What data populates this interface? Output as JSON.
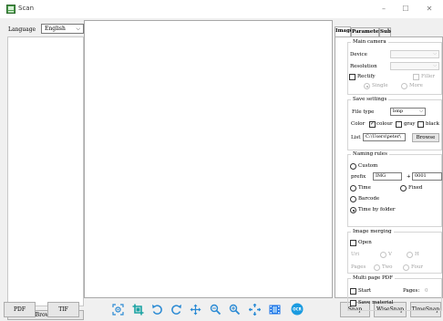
{
  "window": {
    "title": "Scan",
    "minimize": "–",
    "maximize": "☐",
    "close": "✕"
  },
  "left": {
    "language_label": "Language",
    "language_value": "English",
    "browse_label": "Browse"
  },
  "bottom": {
    "pdf_label": "PDF",
    "tif_label": "TIF",
    "snap_label": "Snap",
    "wisesnap_label": "WiseSnap",
    "timesnap_label": "TimeSnap"
  },
  "tabs": [
    {
      "label": "Image"
    },
    {
      "label": "Parameter"
    },
    {
      "label": "Sub"
    }
  ],
  "main_camera": {
    "title": "Main camera",
    "device_label": "Device",
    "device_value": "",
    "resolution_label": "Resolution",
    "resolution_value": "",
    "rectify_label": "Rectify",
    "filler_label": "Filler",
    "single_label": "Single",
    "more_label": "More"
  },
  "save_settings": {
    "title": "Save settings",
    "file_type_label": "File type",
    "file_type_value": "bmp",
    "color_label": "Color",
    "colour_label": "colour",
    "gray_label": "gray",
    "black_label": "black",
    "list_label": "List",
    "list_path": "C:\\Users\\peter\\",
    "browse_label": "Browse"
  },
  "naming_rules": {
    "title": "Naming rules",
    "custom_label": "Custom",
    "prefix_label": "prefix",
    "prefix_value": "IMG",
    "plus_label": "+",
    "number_value": "0001",
    "time_label": "Time",
    "fixed_label": "Fixed",
    "barcode_label": "Barcode",
    "time_by_folder_label": "Time by folder"
  },
  "image_merging": {
    "title": "Image merging",
    "open_label": "Open",
    "uri_label": "Uri",
    "v_label": "V",
    "h_label": "H",
    "pages_label": "Pages",
    "two_label": "Two",
    "four_label": "Four"
  },
  "multi_pdf": {
    "title": "Multi page PDF",
    "start_label": "Start",
    "pages_label": "Pages:",
    "pages_value": "0",
    "save_material_label": "Save material"
  },
  "toolbar_icons": [
    "capture-target-icon",
    "crop-icon",
    "rotate-left-icon",
    "rotate-right-icon",
    "move-icon",
    "zoom-out-icon",
    "zoom-in-icon",
    "fit-window-icon",
    "film-icon",
    "ocr-icon"
  ],
  "colors": {
    "accent_blue": "#1a73e8",
    "icon_blue": "#2a8ad4",
    "icon_teal": "#1aa3a3",
    "checked_radio": "#222222"
  }
}
